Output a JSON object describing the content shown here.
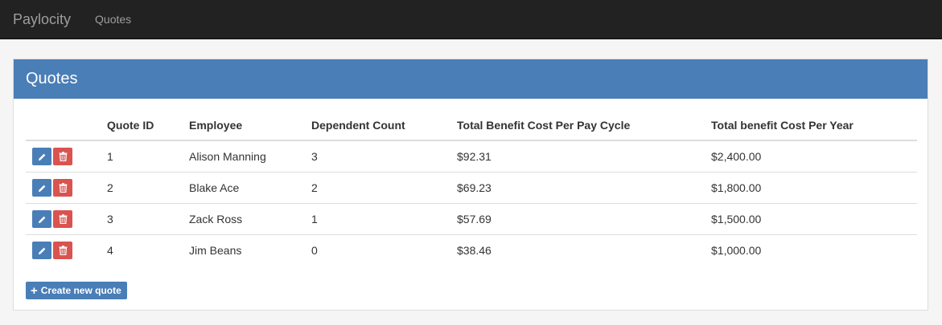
{
  "navbar": {
    "brand": "Paylocity",
    "nav_quotes": "Quotes"
  },
  "panel": {
    "title": "Quotes"
  },
  "table": {
    "headers": [
      "Quote ID",
      "Employee",
      "Dependent Count",
      "Total Benefit Cost Per Pay Cycle",
      "Total benefit Cost Per Year"
    ],
    "rows": [
      [
        "1",
        "Alison Manning",
        "3",
        "$92.31",
        "$2,400.00"
      ],
      [
        "2",
        "Blake Ace",
        "2",
        "$69.23",
        "$1,800.00"
      ],
      [
        "3",
        "Zack Ross",
        "1",
        "$57.69",
        "$1,500.00"
      ],
      [
        "4",
        "Jim Beans",
        "0",
        "$38.46",
        "$1,000.00"
      ]
    ]
  },
  "actions": {
    "create_label": "Create new quote"
  },
  "colors": {
    "navbar": "#222222",
    "primary": "#4a7eb7",
    "danger": "#d9534f"
  },
  "icons": {
    "edit": "pencil-icon",
    "delete": "trash-icon",
    "create": "plus-icon"
  }
}
